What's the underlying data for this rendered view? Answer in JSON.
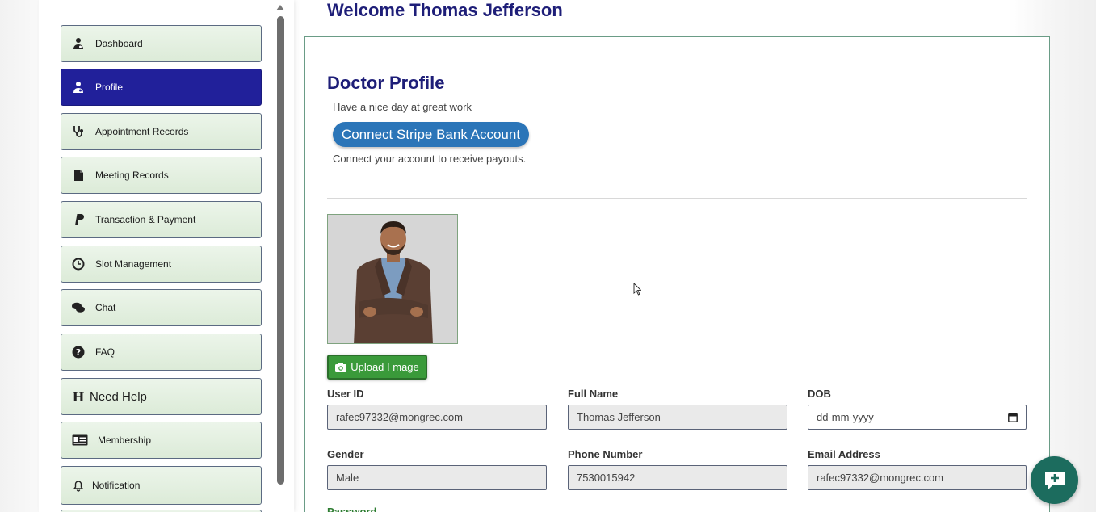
{
  "header": {
    "welcome": "Welcome Thomas Jefferson"
  },
  "sidebar": {
    "items": [
      {
        "label": "Dashboard",
        "icon": "doctor-icon",
        "active": false
      },
      {
        "label": "Profile",
        "icon": "doctor-icon",
        "active": true
      },
      {
        "label": "Appointment Records",
        "icon": "stethoscope-icon",
        "active": false
      },
      {
        "label": "Meeting Records",
        "icon": "file-icon",
        "active": false
      },
      {
        "label": "Transaction & Payment",
        "icon": "paypal-icon",
        "active": false
      },
      {
        "label": "Slot Management",
        "icon": "clock-icon",
        "active": false
      },
      {
        "label": "Chat",
        "icon": "chat-bubbles-icon",
        "active": false
      },
      {
        "label": "FAQ",
        "icon": "question-circle-icon",
        "active": false
      },
      {
        "label": "Need Help",
        "icon": "h-letter-icon",
        "active": false
      },
      {
        "label": "Membership",
        "icon": "id-card-icon",
        "active": false
      },
      {
        "label": "Notification",
        "icon": "bell-icon",
        "active": false
      }
    ]
  },
  "profile": {
    "title": "Doctor Profile",
    "subtitle": "Have a nice day at great work",
    "stripe_button": "Connect Stripe Bank Account",
    "stripe_note": "Connect your account to receive payouts.",
    "upload_button": "Upload I mage"
  },
  "form": {
    "user_id": {
      "label": "User ID",
      "value": "rafec97332@mongrec.com"
    },
    "full_name": {
      "label": "Full Name",
      "value": "Thomas Jefferson"
    },
    "dob": {
      "label": "DOB",
      "placeholder": "dd-mm-yyyy"
    },
    "gender": {
      "label": "Gender",
      "value": "Male"
    },
    "phone": {
      "label": "Phone Number",
      "value": "7530015942"
    },
    "email": {
      "label": "Email Address",
      "value": "rafec97332@mongrec.com"
    },
    "password": {
      "label": "Password"
    }
  },
  "colors": {
    "accent_navy": "#21209a",
    "stripe_blue": "#2b75b8",
    "upload_green": "#3a9a3a",
    "fab_teal": "#1c6c5e"
  }
}
